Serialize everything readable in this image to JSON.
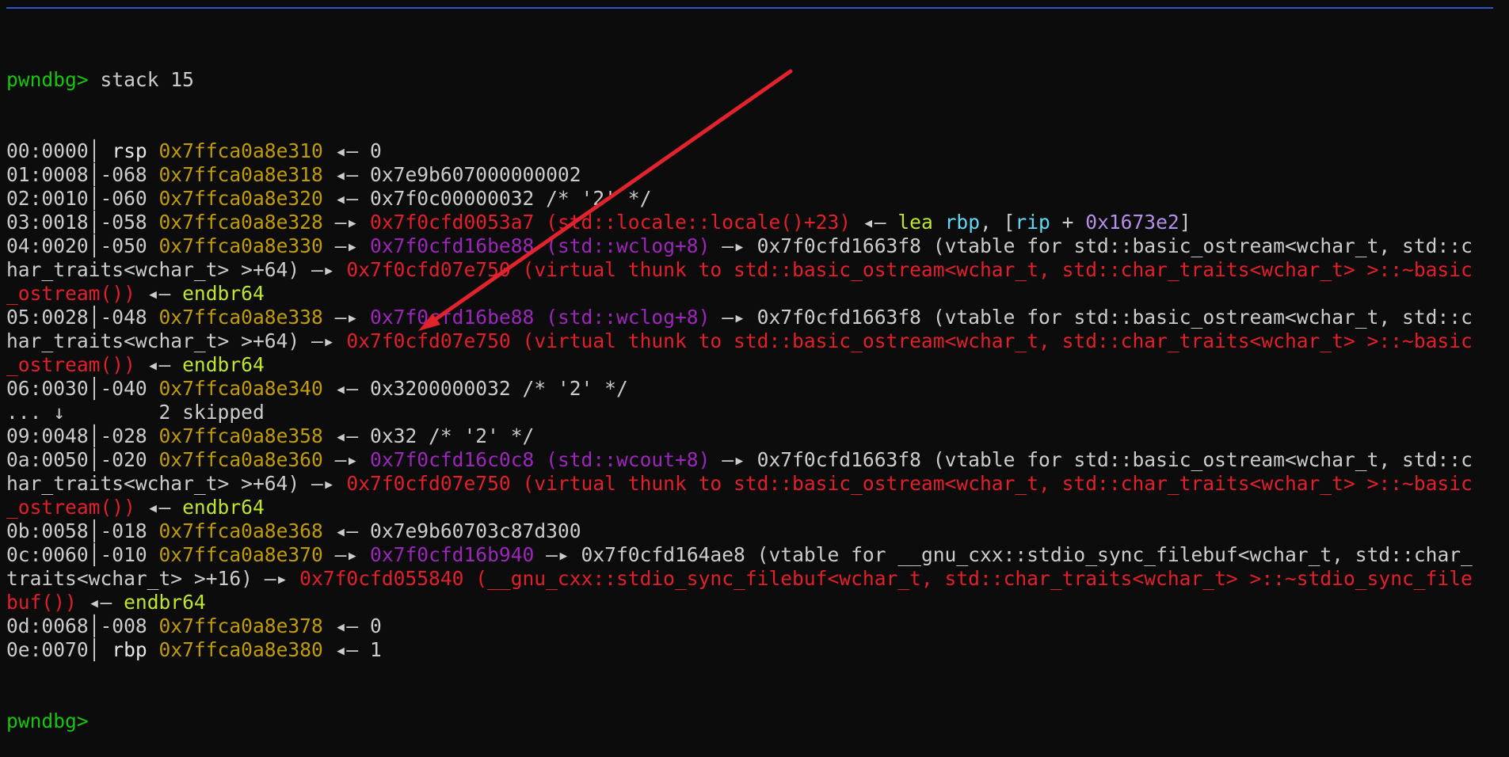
{
  "terminal": {
    "prompt": "pwndbg>",
    "command": " stack 15",
    "lines": [
      [
        [
          "00:0000",
          "df"
        ],
        [
          "│ ",
          "df"
        ],
        [
          "rsp",
          "wh"
        ],
        [
          " ",
          "df"
        ],
        [
          "0x7ffca0a8e310",
          "ye"
        ],
        [
          " ◂— 0",
          "df"
        ]
      ],
      [
        [
          "01:0008",
          "df"
        ],
        [
          "│-068 ",
          "df"
        ],
        [
          "0x7ffca0a8e318",
          "ye"
        ],
        [
          " ◂— 0x7e9b607000000002",
          "df"
        ]
      ],
      [
        [
          "02:0010",
          "df"
        ],
        [
          "│-060 ",
          "df"
        ],
        [
          "0x7ffca0a8e320",
          "ye"
        ],
        [
          " ◂— 0x7f0c00000032 /* '2' */",
          "df"
        ]
      ],
      [
        [
          "03:0018",
          "df"
        ],
        [
          "│-058 ",
          "df"
        ],
        [
          "0x7ffca0a8e328",
          "ye"
        ],
        [
          " —▸ ",
          "df"
        ],
        [
          "0x7f0cfd0053a7 (std::locale::locale()+23)",
          "re"
        ],
        [
          " ◂— ",
          "df"
        ],
        [
          "lea",
          "lg"
        ],
        [
          " ",
          "df"
        ],
        [
          "rbp",
          "cy"
        ],
        [
          ", [",
          "df"
        ],
        [
          "rip",
          "cy"
        ],
        [
          " + ",
          "df"
        ],
        [
          "0x1673e2",
          "lp"
        ],
        [
          "]",
          "df"
        ]
      ],
      [
        [
          "04:0020",
          "df"
        ],
        [
          "│-050 ",
          "df"
        ],
        [
          "0x7ffca0a8e330",
          "ye"
        ],
        [
          " —▸ ",
          "df"
        ],
        [
          "0x7f0cfd16be88 (std::wclog+8)",
          "pu"
        ],
        [
          " —▸ 0x7f0cfd1663f8 (vtable for std::basic_ostream<wchar_t, std::c",
          "df"
        ]
      ],
      [
        [
          "har_traits<wchar_t> >+64) —▸ ",
          "df"
        ],
        [
          "0x7f0cfd07e750 (virtual thunk to std::basic_ostream<wchar_t, std::char_traits<wchar_t> >::~basic",
          "re"
        ]
      ],
      [
        [
          "_ostream())",
          "re"
        ],
        [
          " ◂— ",
          "df"
        ],
        [
          "endbr64",
          "lg"
        ]
      ],
      [
        [
          "05:0028",
          "df"
        ],
        [
          "│-048 ",
          "df"
        ],
        [
          "0x7ffca0a8e338",
          "ye"
        ],
        [
          " —▸ ",
          "df"
        ],
        [
          "0x7f0cfd16be88 (std::wclog+8)",
          "pu"
        ],
        [
          " —▸ 0x7f0cfd1663f8 (vtable for std::basic_ostream<wchar_t, std::c",
          "df"
        ]
      ],
      [
        [
          "har_traits<wchar_t> >+64) —▸ ",
          "df"
        ],
        [
          "0x7f0cfd07e750 (virtual thunk to std::basic_ostream<wchar_t, std::char_traits<wchar_t> >::~basic",
          "re"
        ]
      ],
      [
        [
          "_ostream())",
          "re"
        ],
        [
          " ◂— ",
          "df"
        ],
        [
          "endbr64",
          "lg"
        ]
      ],
      [
        [
          "06:0030",
          "df"
        ],
        [
          "│-040 ",
          "df"
        ],
        [
          "0x7ffca0a8e340",
          "ye"
        ],
        [
          " ◂— 0x3200000032 /* '2' */",
          "df"
        ]
      ],
      [
        [
          "... ↓        2 skipped",
          "df"
        ]
      ],
      [
        [
          "09:0048",
          "df"
        ],
        [
          "│-028 ",
          "df"
        ],
        [
          "0x7ffca0a8e358",
          "ye"
        ],
        [
          " ◂— 0x32 /* '2' */",
          "df"
        ]
      ],
      [
        [
          "0a:0050",
          "df"
        ],
        [
          "│-020 ",
          "df"
        ],
        [
          "0x7ffca0a8e360",
          "ye"
        ],
        [
          " —▸ ",
          "df"
        ],
        [
          "0x7f0cfd16c0c8 (std::wcout+8)",
          "pu"
        ],
        [
          " —▸ 0x7f0cfd1663f8 (vtable for std::basic_ostream<wchar_t, std::c",
          "df"
        ]
      ],
      [
        [
          "har_traits<wchar_t> >+64) —▸ ",
          "df"
        ],
        [
          "0x7f0cfd07e750 (virtual thunk to std::basic_ostream<wchar_t, std::char_traits<wchar_t> >::~basic",
          "re"
        ]
      ],
      [
        [
          "_ostream())",
          "re"
        ],
        [
          " ◂— ",
          "df"
        ],
        [
          "endbr64",
          "lg"
        ]
      ],
      [
        [
          "0b:0058",
          "df"
        ],
        [
          "│-018 ",
          "df"
        ],
        [
          "0x7ffca0a8e368",
          "ye"
        ],
        [
          " ◂— 0x7e9b60703c87d300",
          "df"
        ]
      ],
      [
        [
          "0c:0060",
          "df"
        ],
        [
          "│-010 ",
          "df"
        ],
        [
          "0x7ffca0a8e370",
          "ye"
        ],
        [
          " —▸ ",
          "df"
        ],
        [
          "0x7f0cfd16b940",
          "pu"
        ],
        [
          " —▸ 0x7f0cfd164ae8 (vtable for __gnu_cxx::stdio_sync_filebuf<wchar_t, std::char_",
          "df"
        ]
      ],
      [
        [
          "traits<wchar_t> >+16) —▸ ",
          "df"
        ],
        [
          "0x7f0cfd055840 (__gnu_cxx::stdio_sync_filebuf<wchar_t, std::char_traits<wchar_t> >::~stdio_sync_file",
          "re"
        ]
      ],
      [
        [
          "buf())",
          "re"
        ],
        [
          " ◂— ",
          "df"
        ],
        [
          "endbr64",
          "lg"
        ]
      ],
      [
        [
          "0d:0068",
          "df"
        ],
        [
          "│-008 ",
          "df"
        ],
        [
          "0x7ffca0a8e378",
          "ye"
        ],
        [
          " ◂— 0",
          "df"
        ]
      ],
      [
        [
          "0e:0070",
          "df"
        ],
        [
          "│ ",
          "df"
        ],
        [
          "rbp",
          "wh"
        ],
        [
          " ",
          "df"
        ],
        [
          "0x7ffca0a8e380",
          "ye"
        ],
        [
          " ◂— 1",
          "df"
        ]
      ]
    ],
    "final_prompt": "pwndbg>"
  },
  "annotation": {
    "type": "arrow",
    "color": "#e0232c",
    "icon": "red-arrow-icon"
  },
  "colors": {
    "background": "#0c0c0c",
    "prompt": "#16c60c",
    "address": "#c19c00",
    "code": "#e0202a",
    "data": "#9b27b8",
    "instruction": "#bfe62d",
    "register": "#61d6f5",
    "immediate": "#b48ee8"
  }
}
